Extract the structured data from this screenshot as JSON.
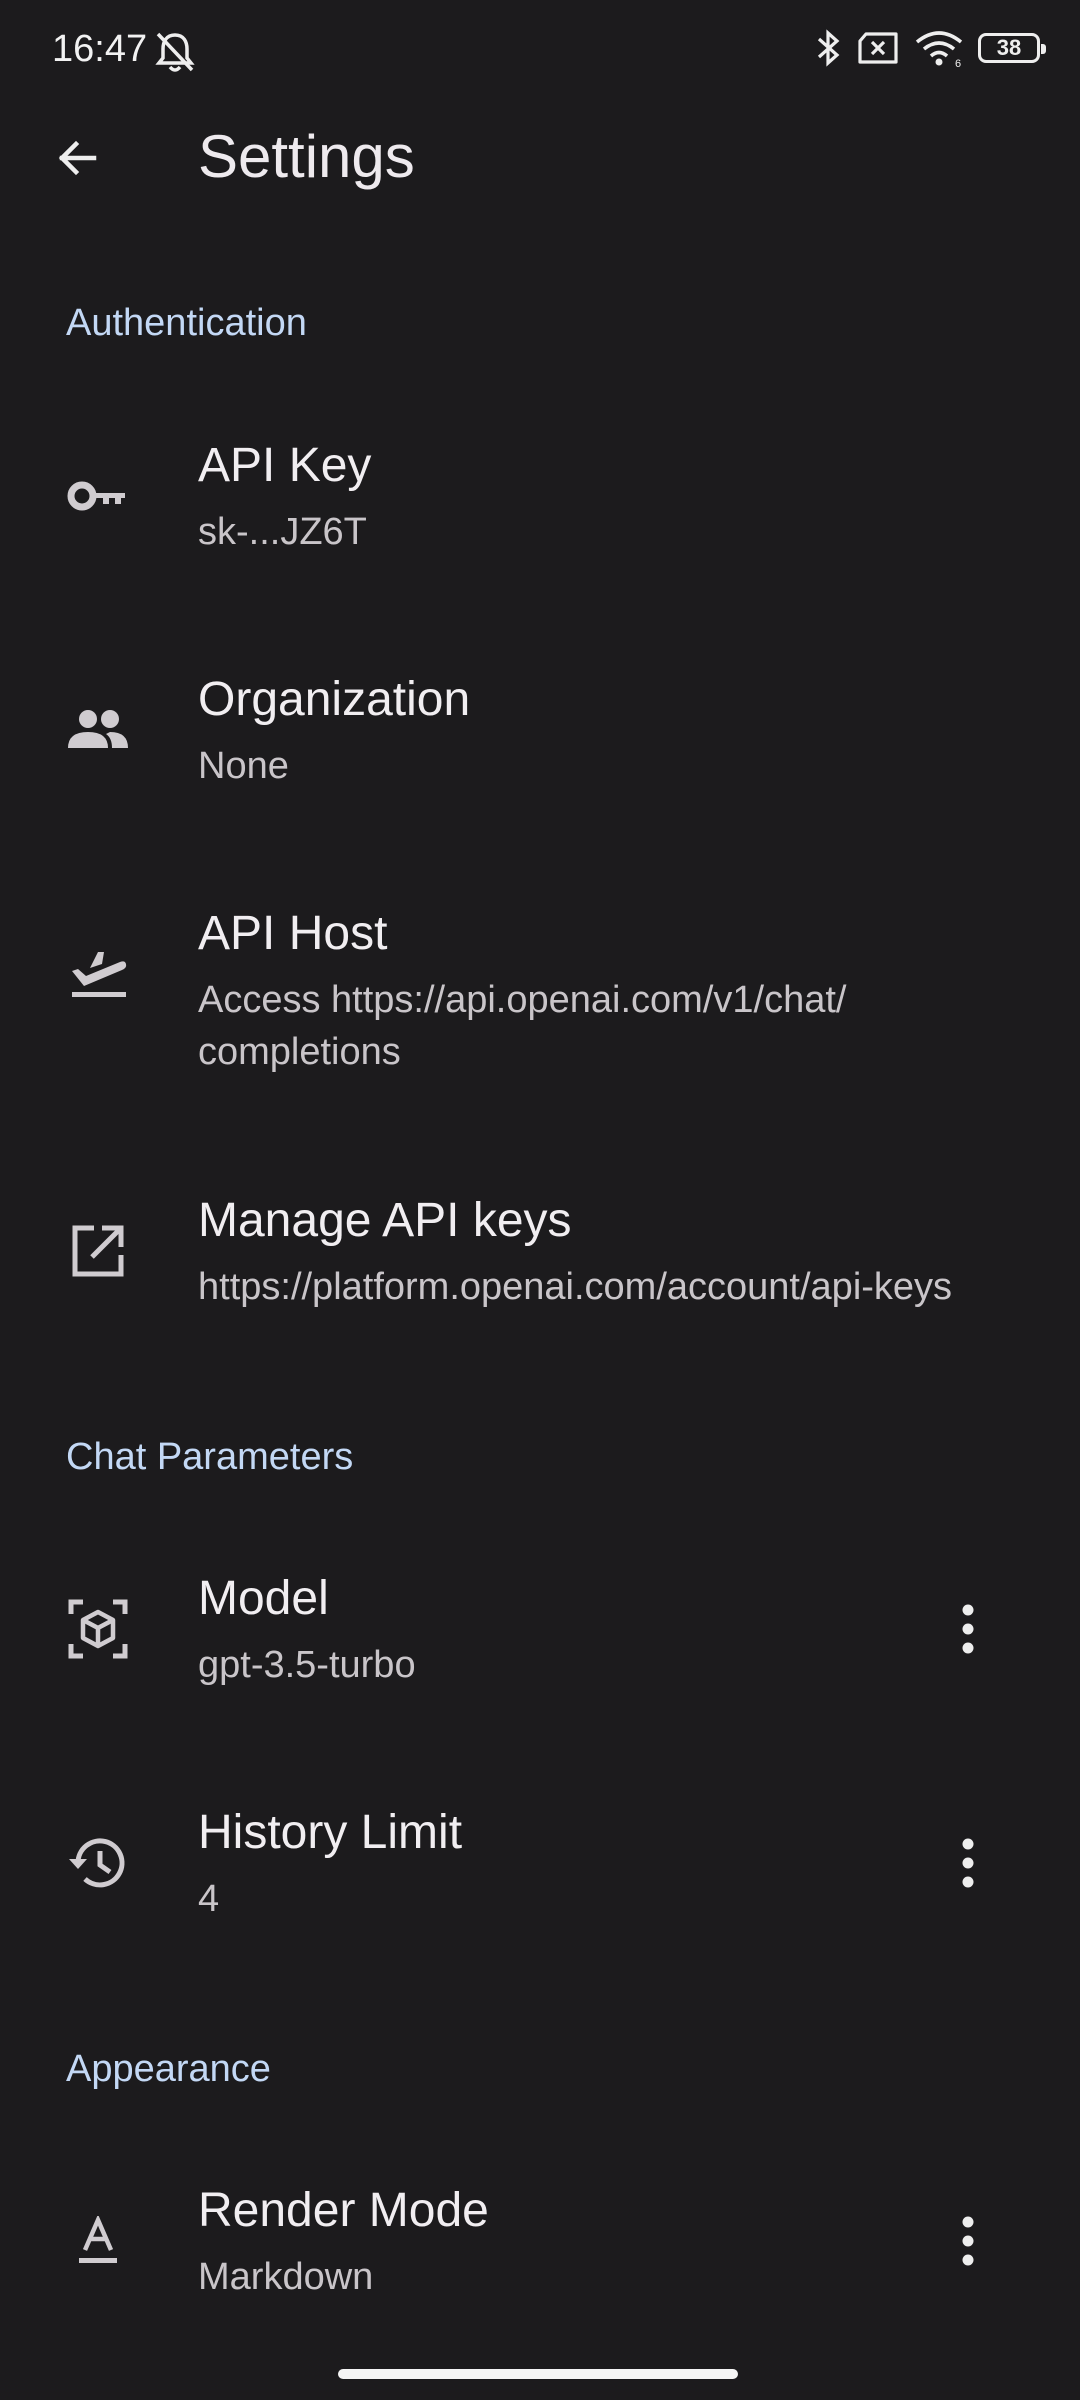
{
  "status_bar": {
    "time": "16:47",
    "battery": "38"
  },
  "app_bar": {
    "title": "Settings"
  },
  "sections": {
    "authentication": {
      "header": "Authentication",
      "api_key": {
        "title": "API Key",
        "subtitle": "sk-...JZ6T",
        "icon": "key-icon"
      },
      "organization": {
        "title": "Organization",
        "subtitle": "None",
        "icon": "group-icon"
      },
      "api_host": {
        "title": "API Host",
        "subtitle": "Access https://api.openai.com/v1/chat/\ncompletions",
        "icon": "flight-takeoff-icon"
      },
      "manage_keys": {
        "title": "Manage API keys",
        "subtitle": "https://platform.openai.com/account/api-keys",
        "icon": "open-in-new-icon"
      }
    },
    "chat_parameters": {
      "header": "Chat Parameters",
      "model": {
        "title": "Model",
        "subtitle": "gpt-3.5-turbo",
        "icon": "model-cube-icon"
      },
      "history_limit": {
        "title": "History Limit",
        "subtitle": "4",
        "icon": "history-icon"
      }
    },
    "appearance": {
      "header": "Appearance",
      "render_mode": {
        "title": "Render Mode",
        "subtitle": "Markdown",
        "icon": "text-format-icon"
      }
    }
  },
  "colors": {
    "background": "#1c1b1d",
    "section_header": "#c3d8f5",
    "primary_text": "#f1eef1",
    "secondary_text": "#c9c5c9"
  }
}
